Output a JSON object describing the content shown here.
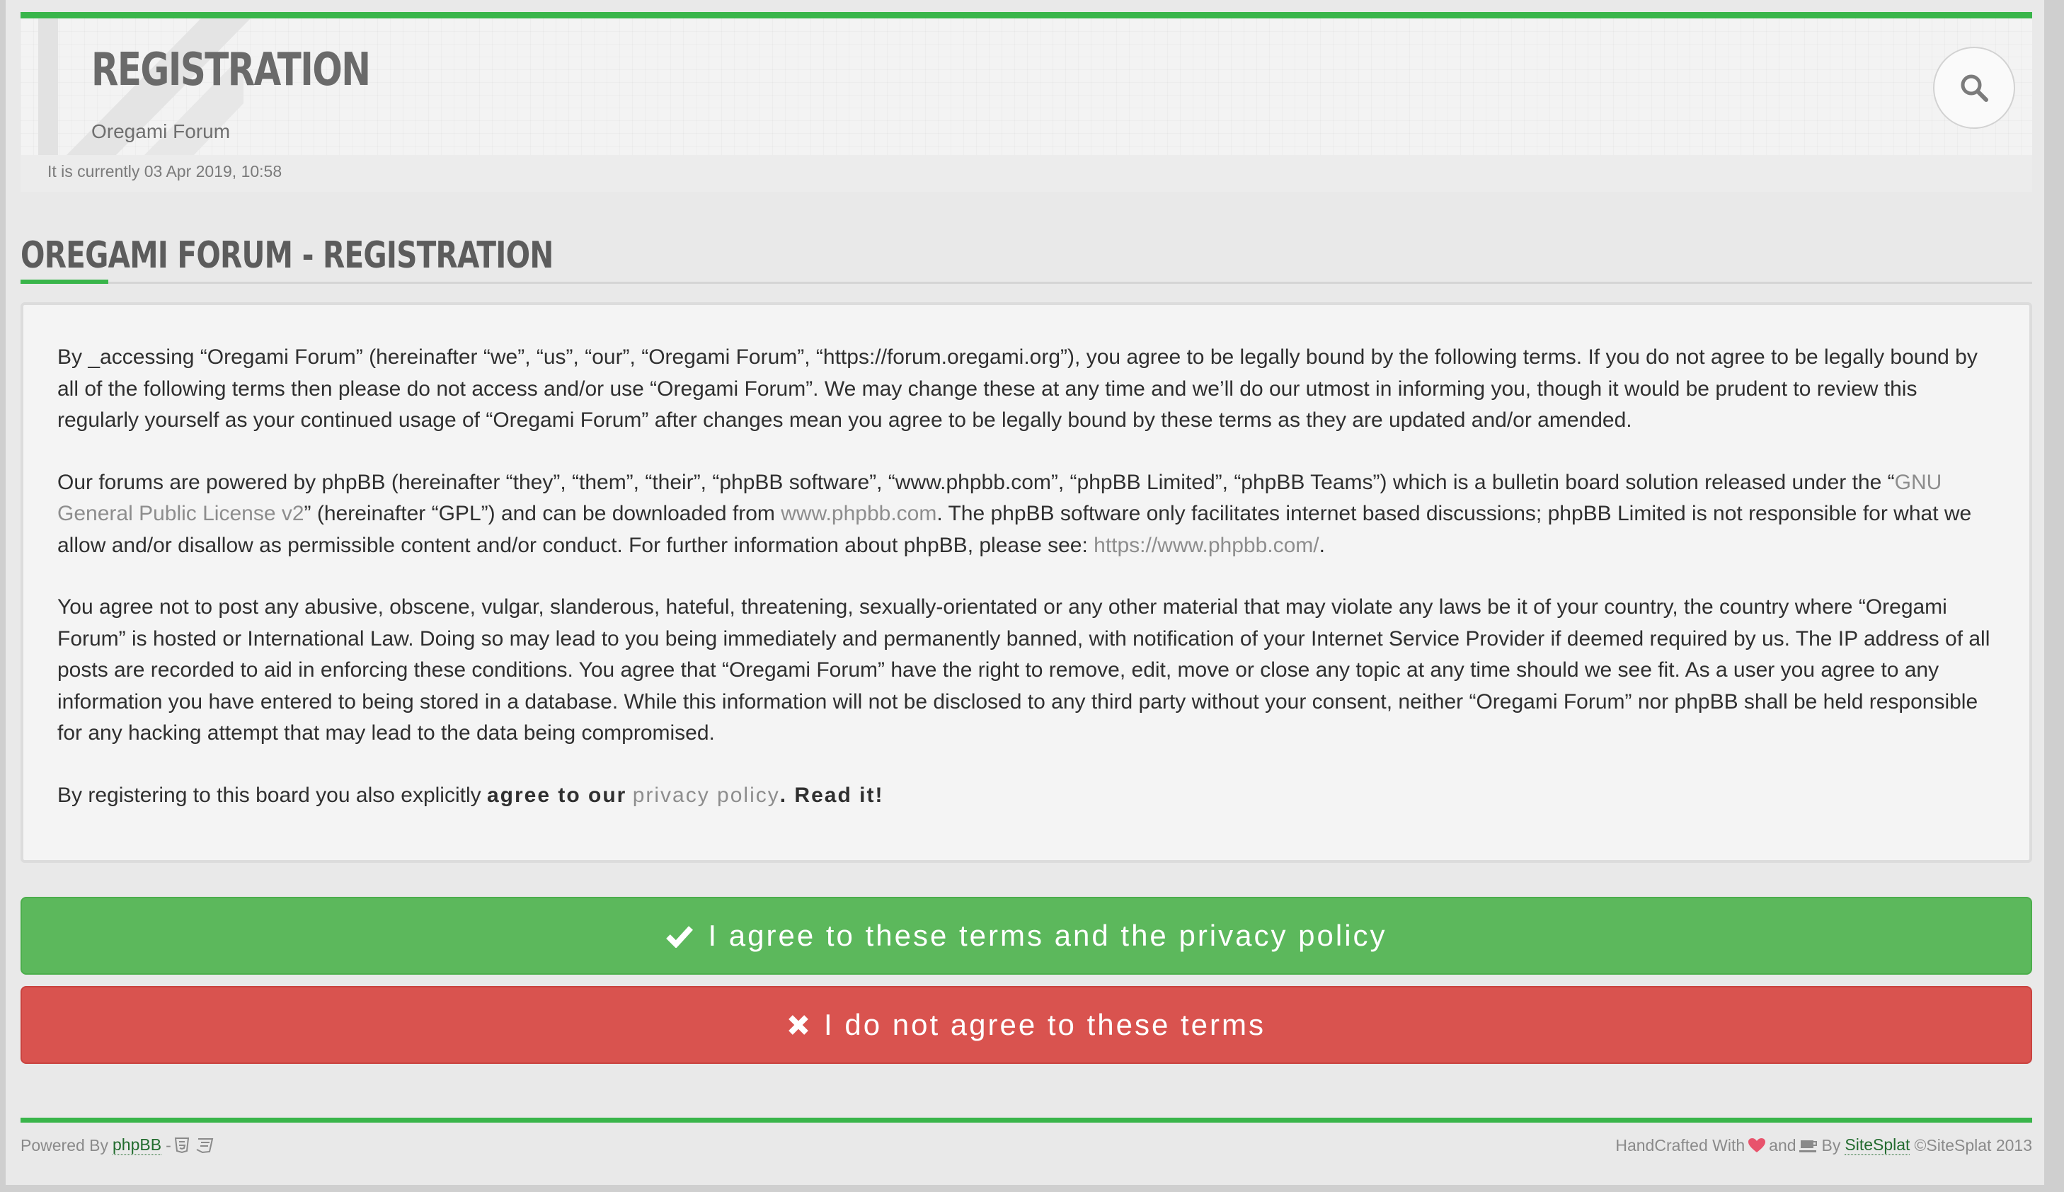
{
  "header": {
    "title": "REGISTRATION",
    "subtitle": "Oregami Forum",
    "current_time": "It is currently 03 Apr 2019, 10:58"
  },
  "page": {
    "title": "OREGAMI FORUM - REGISTRATION"
  },
  "terms": {
    "p1": "By _accessing “Oregami Forum” (hereinafter “we”, “us”, “our”, “Oregami Forum”, “https://forum.oregami.org”), you agree to be legally bound by the following terms. If you do not agree to be legally bound by all of the following terms then please do not access and/or use “Oregami Forum”. We may change these at any time and we’ll do our utmost in informing you, though it would be prudent to review this regularly yourself as your continued usage of “Oregami Forum” after changes mean you agree to be legally bound by these terms as they are updated and/or amended.",
    "p2_a": "Our forums are powered by phpBB (hereinafter “they”, “them”, “their”, “phpBB software”, “www.phpbb.com”, “phpBB Limited”, “phpBB Teams”) which is a bulletin board solution released under the “",
    "p2_link_gpl": "GNU General Public License v2",
    "p2_b": "” (hereinafter “GPL”) and can be downloaded from ",
    "p2_link_phpbb": "www.phpbb.com",
    "p2_c": ". The phpBB software only facilitates internet based discussions; phpBB Limited is not responsible for what we allow and/or disallow as permissible content and/or conduct. For further information about phpBB, please see: ",
    "p2_link_url": "https://www.phpbb.com/",
    "p2_d": ".",
    "p3": "You agree not to post any abusive, obscene, vulgar, slanderous, hateful, threatening, sexually-orientated or any other material that may violate any laws be it of your country, the country where “Oregami Forum” is hosted or International Law. Doing so may lead to you being immediately and permanently banned, with notification of your Internet Service Provider if deemed required by us. The IP address of all posts are recorded to aid in enforcing these conditions. You agree that “Oregami Forum” have the right to remove, edit, move or close any topic at any time should we see fit. As a user you agree to any information you have entered to being stored in a database. While this information will not be disclosed to any third party without your consent, neither “Oregami Forum” nor phpBB shall be held responsible for any hacking attempt that may lead to the data being compromised.",
    "p4_a": "By registering to this board you also explicitly ",
    "p4_strong": "agree to our",
    "p4_link": "privacy policy",
    "p4_end": ". Read it!"
  },
  "buttons": {
    "agree": "I agree to these terms and the privacy policy",
    "disagree": "I do not agree to these terms"
  },
  "footer": {
    "powered_by": "Powered By",
    "phpbb": "phpBB",
    "dash": "-",
    "handcrafted": "HandCrafted With",
    "and": "and",
    "by": "By",
    "sitesplat": "SiteSplat",
    "copyright": "©SiteSplat 2013"
  },
  "colors": {
    "accent_green": "#39b54a",
    "agree_button": "#5cb85c",
    "disagree_button": "#d9534f",
    "heart": "#e8536c"
  },
  "icons": [
    "search-icon",
    "check-icon",
    "times-icon",
    "html5-icon",
    "css3-icon",
    "heart-icon",
    "coffee-icon"
  ]
}
